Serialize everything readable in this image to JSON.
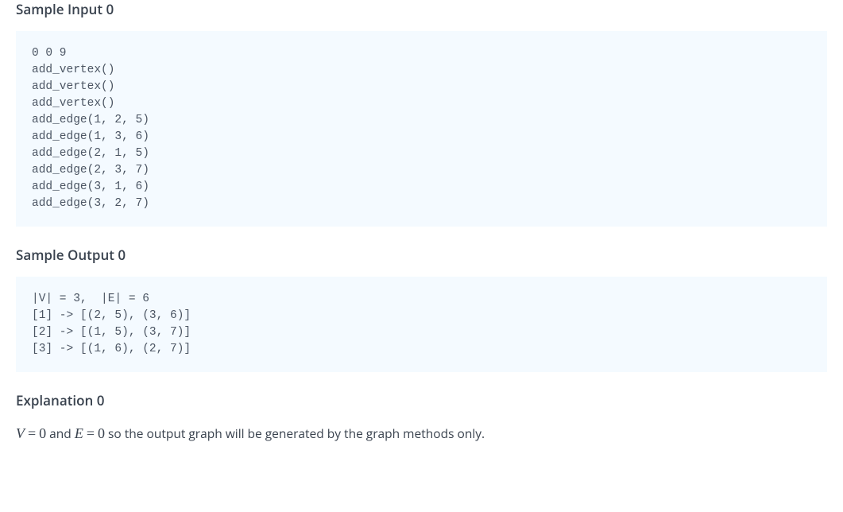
{
  "sections": {
    "sample_input": {
      "heading": "Sample Input 0",
      "code": "0 0 9\nadd_vertex()\nadd_vertex()\nadd_vertex()\nadd_edge(1, 2, 5)\nadd_edge(1, 3, 6)\nadd_edge(2, 1, 5)\nadd_edge(2, 3, 7)\nadd_edge(3, 1, 6)\nadd_edge(3, 2, 7)"
    },
    "sample_output": {
      "heading": "Sample Output 0",
      "code": "|V| = 3,  |E| = 6\n[1] -> [(2, 5), (3, 6)]\n[2] -> [(1, 5), (3, 7)]\n[3] -> [(1, 6), (2, 7)]"
    },
    "explanation": {
      "heading": "Explanation 0",
      "math": {
        "v_var": "V",
        "eq1": "=",
        "v_val": "0",
        "and": " and ",
        "e_var": "E",
        "eq2": "=",
        "e_val": "0"
      },
      "text_tail": " so the output graph will be generated by the graph methods only."
    }
  }
}
